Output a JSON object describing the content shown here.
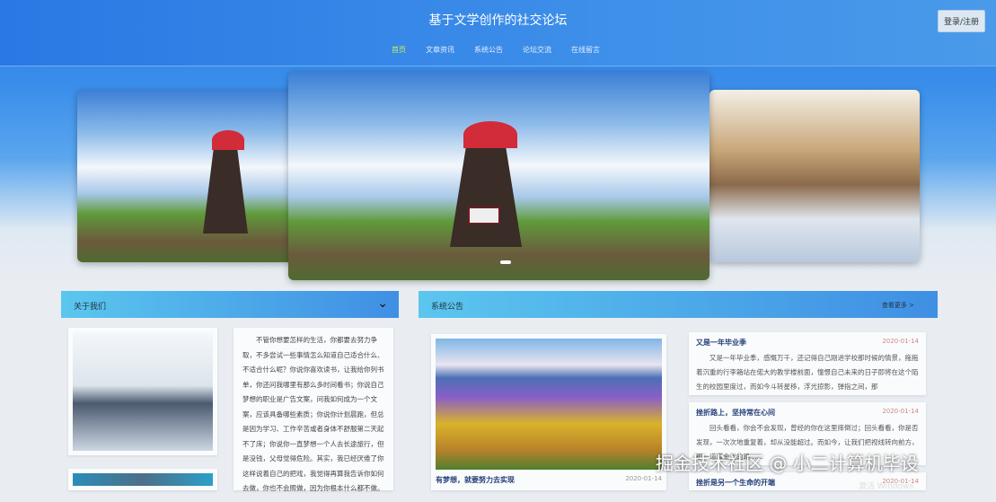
{
  "header": {
    "title": "基于文学创作的社交论坛",
    "login_label": "登录/注册"
  },
  "nav": [
    "首页",
    "文章资讯",
    "系统公告",
    "论坛交流",
    "在线留言"
  ],
  "carousel": {
    "active_index": 1,
    "slides": 3
  },
  "about": {
    "title": "关于我们",
    "text": "不管你想要怎样的生活，你都要去努力争取，不多尝试一些事情怎么知道自己适合什么、不适合什么呢？你说你喜欢读书，让我给你列书单，你还问我哪里有那么多时间看书；你说自己梦想的职业是广告文案，问我如何成为一个文案，应该具备哪些素质；你说你计划晨跑，但总是因为学习、工作辛苦或者身体不舒服第二天起不了床；你说你一直梦想一个人去长途旅行，但是没钱，父母觉得危险。其实，我已经厌倦了你这样说着自己的把戏，我觉得再算我告诉你如何去做，你也不会照做，因为你根本什么都不做。"
  },
  "notices": {
    "title": "系统公告",
    "more_label": "查看更多 >",
    "featured": {
      "title": "有梦想，就要努力去实现",
      "date": "2020-01-14"
    },
    "items": [
      {
        "title": "又是一年毕业季",
        "date": "2020-01-14",
        "text": "又是一年毕业季，感慨万千，还记得自己刚进学校那时候的情景，拖拖着沉重的行李箱站在偌大的教学楼前面，憧憬自己未来的日子即将在这个陌生的校园里度过，而如今斗转星移，浮光掠影，弹指之间，那"
      },
      {
        "title": "挫折路上，坚持常在心间",
        "date": "2020-01-14",
        "text": "回头看看，你会不会发现，曾经的你在这里摔倒过；回头看看，你是否发现，一次次地重复着，却从没能超过。而如今，让我们把视线转向前方，那一道道金光的路……"
      },
      {
        "title": "挫折是另一个生命的开端",
        "date": "2020-01-14"
      }
    ]
  },
  "watermark": {
    "text": "掘金技术社区 @ 小二计算机毕设",
    "sub": "激活 Windows"
  }
}
